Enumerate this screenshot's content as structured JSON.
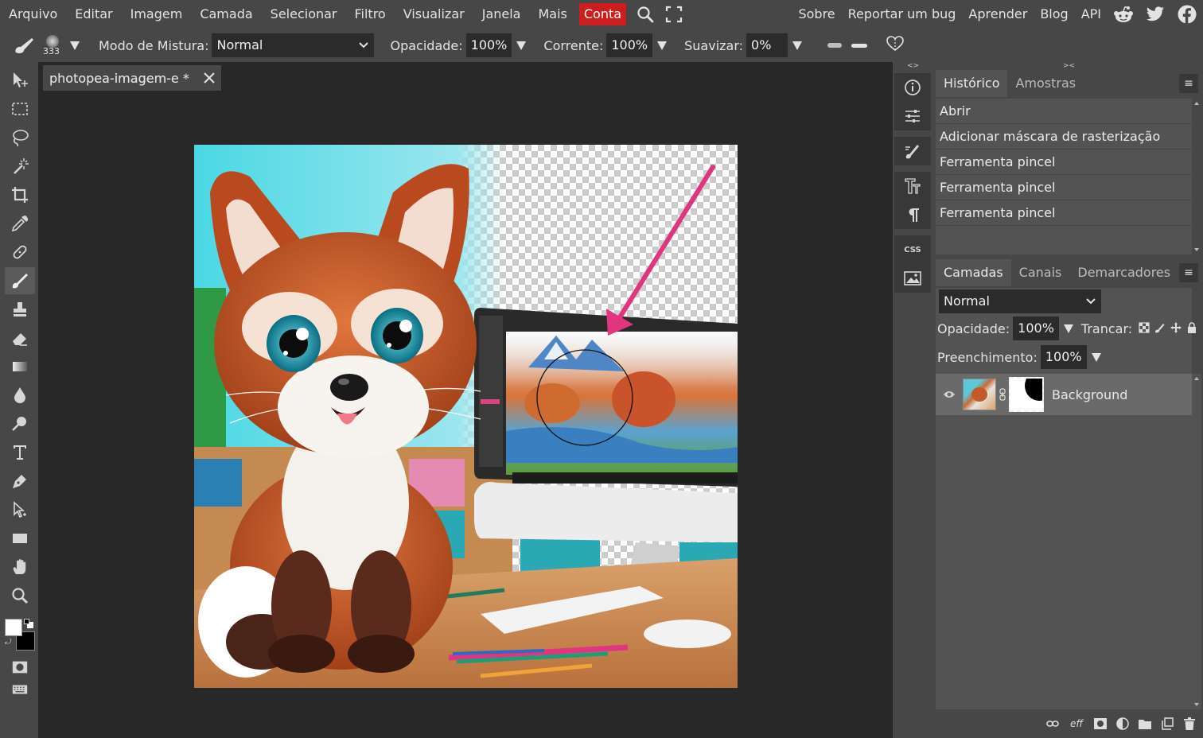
{
  "menubar": {
    "items": [
      "Arquivo",
      "Editar",
      "Imagem",
      "Camada",
      "Selecionar",
      "Filtro",
      "Visualizar",
      "Janela",
      "Mais"
    ],
    "account": "Conta",
    "right_items": [
      "Sobre",
      "Reportar um bug",
      "Aprender",
      "Blog",
      "API"
    ],
    "social": [
      "reddit-icon",
      "twitter-icon",
      "facebook-icon"
    ],
    "colors": {
      "account_bg": "#cc1e1e"
    }
  },
  "options": {
    "brush_size": "333",
    "blend_label": "Modo de Mistura:",
    "blend_value": "Normal",
    "opacity_label": "Opacidade:",
    "opacity_value": "100%",
    "flow_label": "Corrente:",
    "flow_value": "100%",
    "smooth_label": "Suavizar:",
    "smooth_value": "0%"
  },
  "document": {
    "tab_title": "photopea-imagem-e *",
    "arrow_color": "#e0357f"
  },
  "panels_collapse": {
    "left": "<>",
    "right": "><"
  },
  "history": {
    "tabs": [
      "Histórico",
      "Amostras"
    ],
    "items": [
      "Abrir",
      "Adicionar máscara de rasterização",
      "Ferramenta pincel",
      "Ferramenta pincel",
      "Ferramenta pincel"
    ]
  },
  "layers": {
    "tabs": [
      "Camadas",
      "Canais",
      "Demarcadores"
    ],
    "blend_mode": "Normal",
    "opacity_label": "Opacidade:",
    "opacity_value": "100%",
    "lock_label": "Trancar:",
    "fill_label": "Preenchimento:",
    "fill_value": "100%",
    "items": [
      {
        "name": "Background",
        "visible": true
      }
    ],
    "footer_icons": [
      "link-icon",
      "effects-icon",
      "mask-icon",
      "adjustment-icon",
      "folder-icon",
      "new-layer-icon",
      "trash-icon"
    ],
    "footer_eff": "eff"
  },
  "strip": {
    "css_label": "CSS"
  },
  "colors": {
    "foreground": "#ffffff",
    "background": "#000000"
  }
}
